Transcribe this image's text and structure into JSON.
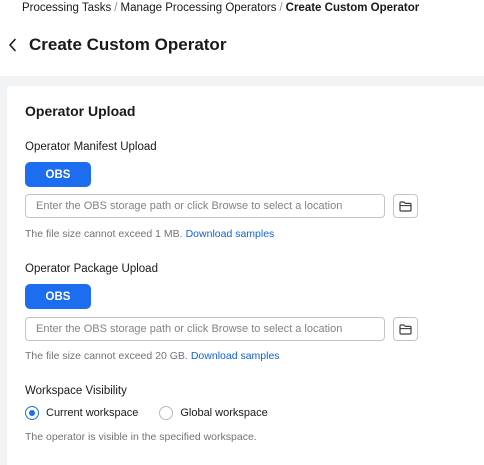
{
  "breadcrumb": {
    "items": [
      "Processing Tasks",
      "Manage Processing Operators"
    ],
    "current": "Create Custom Operator",
    "separator": "/"
  },
  "page": {
    "title": "Create Custom Operator"
  },
  "upload": {
    "section_title": "Operator Upload",
    "manifest": {
      "label": "Operator Manifest Upload",
      "source_button": "OBS",
      "placeholder": "Enter the OBS storage path or click Browse to select a location",
      "value": "",
      "hint": "The file size cannot exceed 1 MB.",
      "link": "Download samples"
    },
    "package": {
      "label": "Operator Package Upload",
      "source_button": "OBS",
      "placeholder": "Enter the OBS storage path or click Browse to select a location",
      "value": "",
      "hint": "The file size cannot exceed 20 GB.",
      "link": "Download samples"
    }
  },
  "visibility": {
    "label": "Workspace Visibility",
    "options": [
      {
        "label": "Current workspace",
        "selected": true
      },
      {
        "label": "Global workspace",
        "selected": false
      }
    ],
    "hint": "The operator is visible in the specified workspace."
  },
  "colors": {
    "accent": "#1c6df0",
    "link": "#0c63e4",
    "page_background": "#f2f3f5"
  },
  "icons": {
    "back": "chevron-left-icon",
    "browse": "folder-icon"
  }
}
